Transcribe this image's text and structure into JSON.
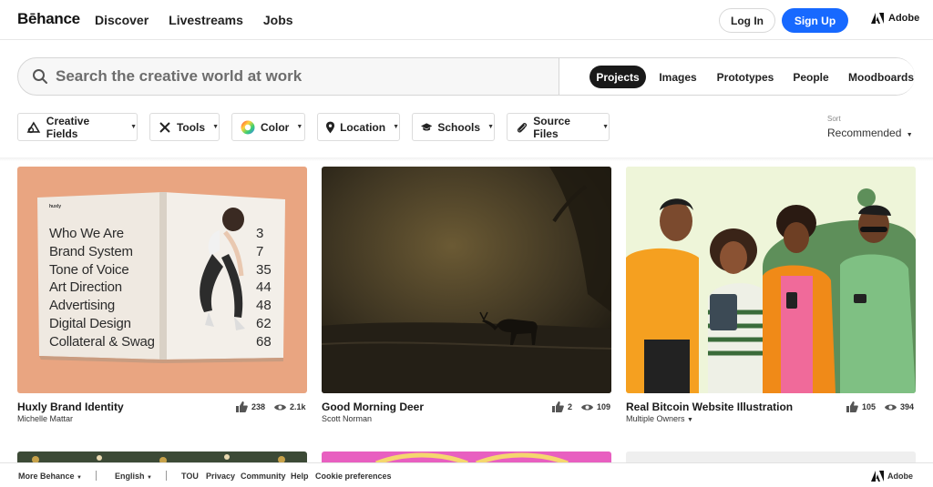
{
  "header": {
    "logo": "Bēhance",
    "nav": [
      "Discover",
      "Livestreams",
      "Jobs"
    ],
    "login": "Log In",
    "signup": "Sign Up",
    "adobe": "Adobe"
  },
  "search": {
    "placeholder": "Search the creative world at work",
    "tabs": [
      {
        "label": "Projects",
        "active": true
      },
      {
        "label": "Images",
        "active": false
      },
      {
        "label": "Prototypes",
        "active": false
      },
      {
        "label": "People",
        "active": false
      },
      {
        "label": "Moodboards",
        "active": false
      }
    ]
  },
  "filters": [
    {
      "label": "Creative Fields",
      "icon": "creative-fields-icon"
    },
    {
      "label": "Tools",
      "icon": "tools-icon"
    },
    {
      "label": "Color",
      "icon": "color-wheel-icon"
    },
    {
      "label": "Location",
      "icon": "location-pin-icon"
    },
    {
      "label": "Schools",
      "icon": "graduation-cap-icon"
    },
    {
      "label": "Source Files",
      "icon": "paperclip-icon"
    }
  ],
  "sort": {
    "label": "Sort",
    "value": "Recommended"
  },
  "book": {
    "brand": "huxly",
    "toc": [
      {
        "item": "Who We Are",
        "page": "3"
      },
      {
        "item": "Brand System",
        "page": "7"
      },
      {
        "item": "Tone of Voice",
        "page": "35"
      },
      {
        "item": "Art Direction",
        "page": "44"
      },
      {
        "item": "Advertising",
        "page": "48"
      },
      {
        "item": "Digital Design",
        "page": "62"
      },
      {
        "item": "Collateral & Swag",
        "page": "68"
      }
    ]
  },
  "projects": [
    {
      "title": "Huxly Brand Identity",
      "owner": "Michelle Mattar",
      "likes": "238",
      "views": "2.1k"
    },
    {
      "title": "Good Morning Deer",
      "owner": "Scott Norman",
      "likes": "2",
      "views": "109"
    },
    {
      "title": "Real Bitcoin Website Illustration",
      "owner": "Multiple Owners",
      "likes": "105",
      "views": "394"
    }
  ],
  "footer": {
    "more": "More Behance",
    "language": "English",
    "links": [
      "TOU",
      "Privacy",
      "Community",
      "Help",
      "Cookie preferences"
    ],
    "adobe": "Adobe"
  },
  "colors": {
    "accent": "#1769ff",
    "active_tab": "#191919"
  }
}
